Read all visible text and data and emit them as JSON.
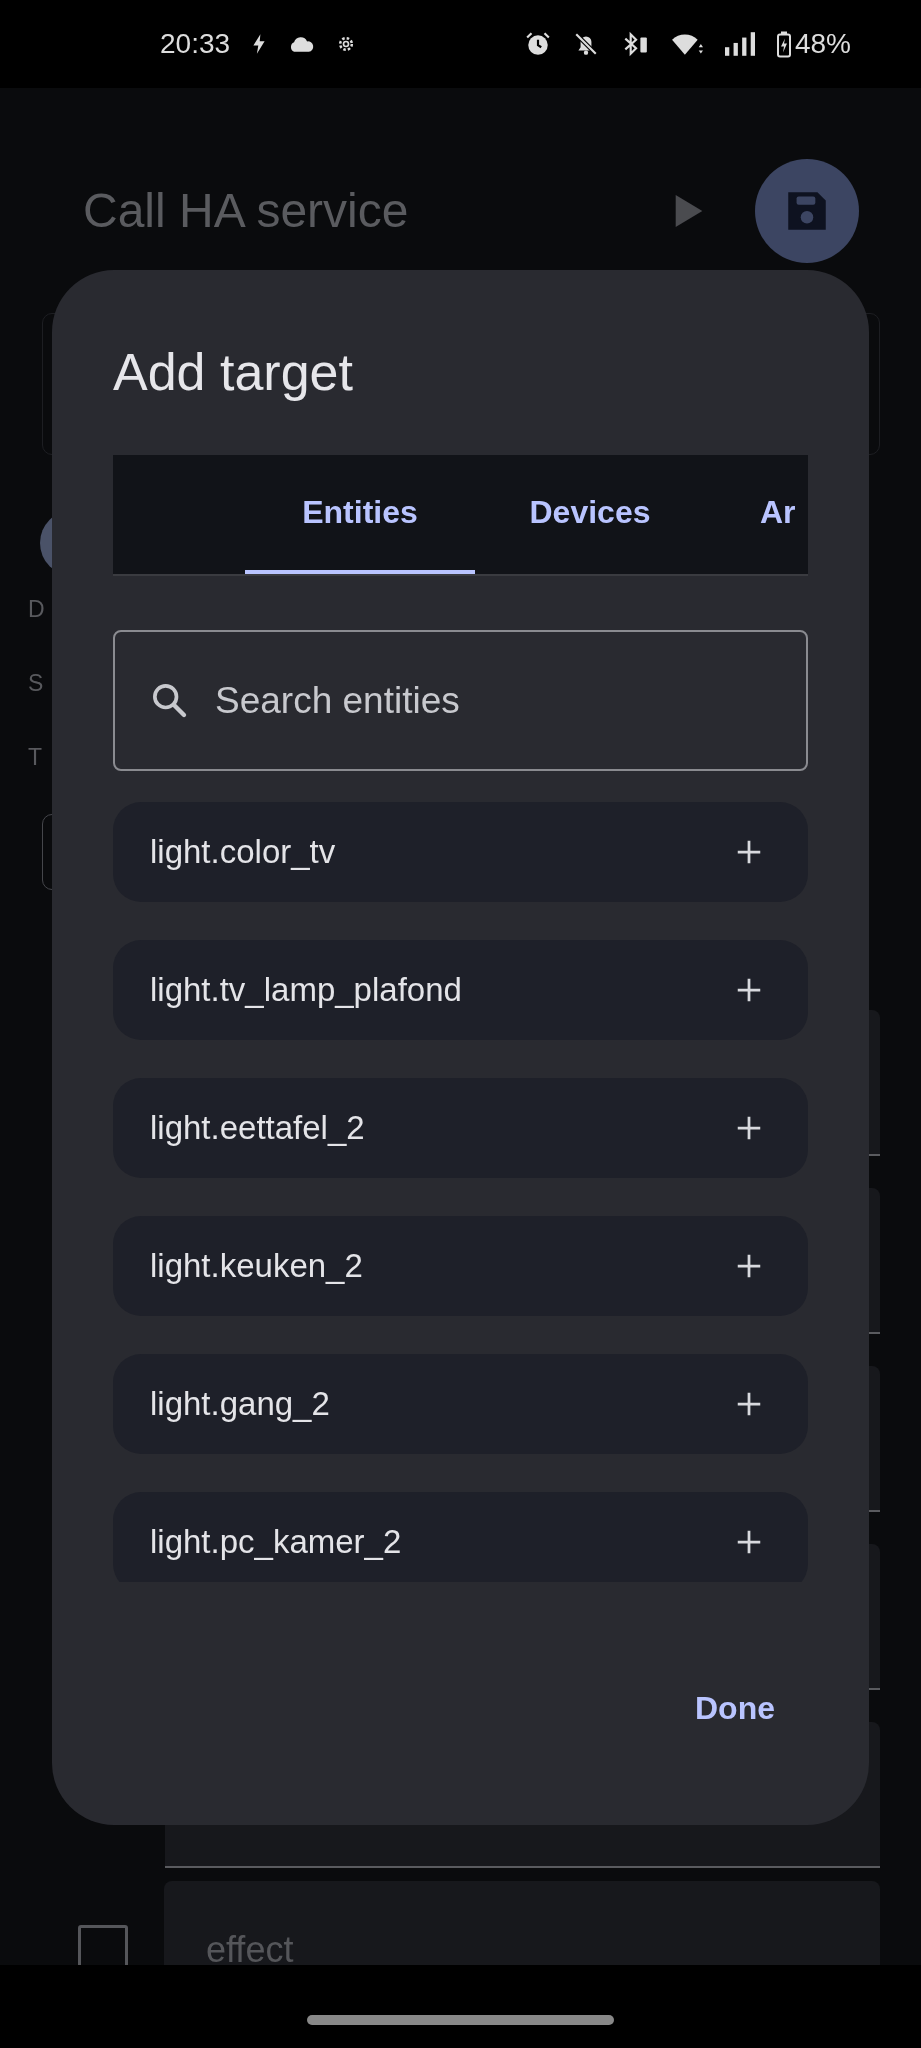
{
  "status_bar": {
    "time": "20:33",
    "battery": "48%"
  },
  "screen": {
    "title": "Call HA service",
    "labels": [
      "D",
      "S",
      "T"
    ],
    "effect_field": {
      "label": "effect",
      "checked": false
    }
  },
  "dialog": {
    "title": "Add target",
    "tabs": [
      {
        "label": "Entities",
        "selected": true
      },
      {
        "label": "Devices",
        "selected": false
      },
      {
        "label": "Ar",
        "selected": false
      }
    ],
    "search": {
      "placeholder": "Search entities"
    },
    "entities": [
      "light.color_tv",
      "light.tv_lamp_plafond",
      "light.eettafel_2",
      "light.keuken_2",
      "light.gang_2",
      "light.pc_kamer_2"
    ],
    "done": "Done"
  }
}
